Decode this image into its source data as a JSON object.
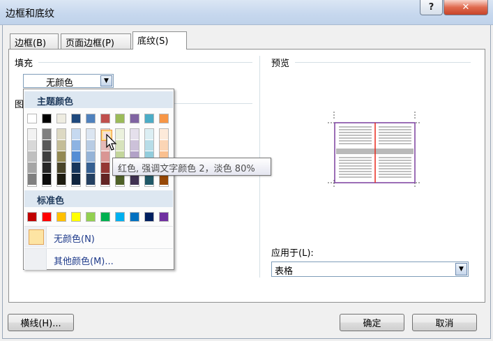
{
  "window": {
    "title": "边框和底纹",
    "help_label": "?",
    "close_label": "✕"
  },
  "tabs": [
    {
      "label": "边框(B)",
      "active": false
    },
    {
      "label": "页面边框(P)",
      "active": false
    },
    {
      "label": "底纹(S)",
      "active": true
    }
  ],
  "fill": {
    "label": "填充",
    "selected": "无颜色",
    "pattern_label_partial": "图"
  },
  "palette": {
    "theme_header": "主题颜色",
    "standard_header": "标准色",
    "theme_top_row": [
      "#ffffff",
      "#000000",
      "#eeece1",
      "#1f497d",
      "#4f81bd",
      "#c0504d",
      "#9bbb59",
      "#8064a2",
      "#4bacc6",
      "#f79646"
    ],
    "theme_shades": [
      [
        "#f2f2f2",
        "#d8d8d8",
        "#bfbfbf",
        "#a5a5a5",
        "#7f7f7f"
      ],
      [
        "#7f7f7f",
        "#595959",
        "#3f3f3f",
        "#262626",
        "#0c0c0c"
      ],
      [
        "#ddd9c3",
        "#c4bd97",
        "#938953",
        "#494429",
        "#1d1b10"
      ],
      [
        "#c6d9f0",
        "#8db3e2",
        "#548dd4",
        "#17365d",
        "#0f243e"
      ],
      [
        "#dbe5f1",
        "#b8cce4",
        "#95b3d7",
        "#366092",
        "#244061"
      ],
      [
        "#f2dcdb",
        "#e5b9b7",
        "#d99694",
        "#953734",
        "#632423"
      ],
      [
        "#ebf1dd",
        "#d7e3bc",
        "#c3d69b",
        "#76923c",
        "#4f6128"
      ],
      [
        "#e5e0ec",
        "#ccc1d9",
        "#b2a2c7",
        "#5f497a",
        "#3f3151"
      ],
      [
        "#dbeef3",
        "#b7dde8",
        "#92cddc",
        "#31859b",
        "#205867"
      ],
      [
        "#fdeada",
        "#fbd5b5",
        "#fac08f",
        "#e36c09",
        "#974806"
      ]
    ],
    "standard_colors": [
      "#c00000",
      "#ff0000",
      "#ffc000",
      "#ffff00",
      "#92d050",
      "#00b050",
      "#00b0f0",
      "#0070c0",
      "#002060",
      "#7030a0"
    ],
    "no_color_label": "无颜色(N)",
    "more_colors_label": "其他颜色(M)...",
    "tooltip": "红色, 强调文字颜色 2，淡色 80%"
  },
  "preview": {
    "label": "预览",
    "apply_to_label": "应用于(L):",
    "apply_to_value": "表格"
  },
  "buttons": {
    "horizontal_line": "横线(H)...",
    "ok": "确定",
    "cancel": "取消"
  }
}
